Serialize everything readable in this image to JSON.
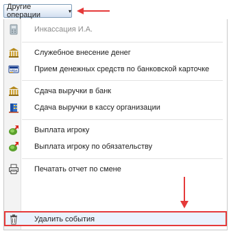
{
  "toolbar": {
    "ops_button_label": "Другие операции",
    "caret": "▾"
  },
  "menu": {
    "items": [
      {
        "label": "Инкассация И.А.",
        "icon": "cash-register-icon",
        "disabled": true
      },
      {
        "label": "Служебное внесение денег",
        "icon": "bank-icon"
      },
      {
        "label": "Прием денежных средств по банковской карточке",
        "icon": "visa-card-icon"
      },
      {
        "label": "Сдача выручки в банк",
        "icon": "bank-icon"
      },
      {
        "label": "Сдача выручки в кассу организации",
        "icon": "building-icon"
      },
      {
        "label": "Выплата игроку",
        "icon": "money-payout-icon"
      },
      {
        "label": "Выплата игроку по обязательству",
        "icon": "money-payout-icon"
      },
      {
        "label": "Печатать отчет по смене",
        "icon": "printer-icon"
      },
      {
        "label": "Удалить события",
        "icon": "trash-icon",
        "highlighted": true
      }
    ]
  },
  "colors": {
    "annotation_red": "#e53939",
    "highlight_bg": "#eaf2fd"
  }
}
